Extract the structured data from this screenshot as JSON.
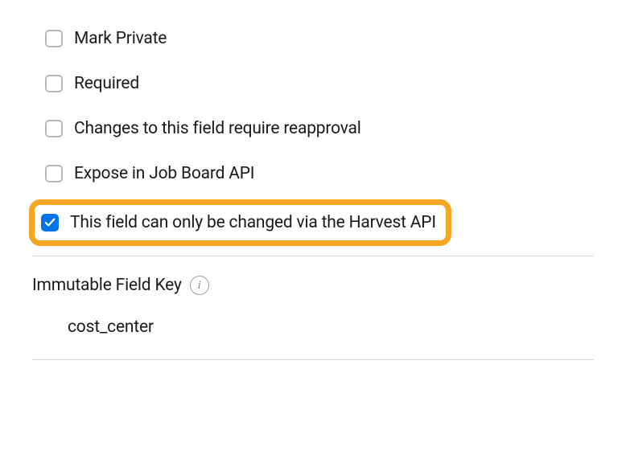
{
  "options": [
    {
      "id": "mark-private",
      "label": "Mark Private",
      "checked": false,
      "highlighted": false
    },
    {
      "id": "required",
      "label": "Required",
      "checked": false,
      "highlighted": false
    },
    {
      "id": "reapproval",
      "label": "Changes to this field require reapproval",
      "checked": false,
      "highlighted": false
    },
    {
      "id": "expose-api",
      "label": "Expose in Job Board API",
      "checked": false,
      "highlighted": false
    },
    {
      "id": "harvest-only",
      "label": "This field can only be changed via the Harvest API",
      "checked": true,
      "highlighted": true
    }
  ],
  "section": {
    "title": "Immutable Field Key",
    "info_glyph": "i",
    "value": "cost_center"
  },
  "colors": {
    "highlight_border": "#f5a623",
    "checkbox_checked": "#0073e6"
  }
}
